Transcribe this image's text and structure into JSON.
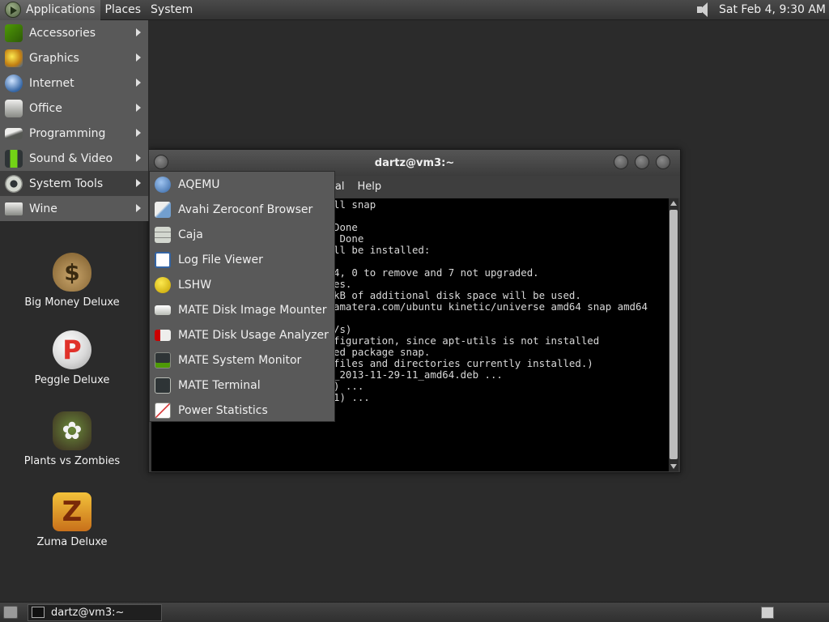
{
  "top_panel": {
    "menus": [
      {
        "label": "Applications"
      },
      {
        "label": "Places"
      },
      {
        "label": "System"
      }
    ],
    "clock": "Sat Feb  4,  9:30 AM"
  },
  "apps_menu": {
    "items": [
      {
        "label": "Accessories",
        "icon": "accessories-icon",
        "color": "#4e9a06"
      },
      {
        "label": "Graphics",
        "icon": "graphics-icon",
        "color": "#c17d11"
      },
      {
        "label": "Internet",
        "icon": "internet-icon",
        "color": "#3465a4"
      },
      {
        "label": "Office",
        "icon": "office-icon",
        "color": "#babdb6"
      },
      {
        "label": "Programming",
        "icon": "programming-icon",
        "color": "#888a85"
      },
      {
        "label": "Sound & Video",
        "icon": "sound-video-icon",
        "color": "#73d216"
      },
      {
        "label": "System Tools",
        "icon": "gear-icon",
        "color": "#d3d7cf"
      },
      {
        "label": "Wine",
        "icon": "wine-icon",
        "color": "#babdb6"
      }
    ]
  },
  "system_tools_menu": {
    "items": [
      {
        "label": "AQEMU",
        "icon": "aqemu-icon",
        "color": "#3465a4"
      },
      {
        "label": "Avahi Zeroconf Browser",
        "icon": "avahi-icon",
        "color": "#729fcf"
      },
      {
        "label": "Caja",
        "icon": "file-cabinet-icon",
        "color": "#d3d7cf"
      },
      {
        "label": "Log File Viewer",
        "icon": "magnifier-icon",
        "color": "#ffffff"
      },
      {
        "label": "LSHW",
        "icon": "lshw-icon",
        "color": "#edd400"
      },
      {
        "label": "MATE Disk Image Mounter",
        "icon": "disk-icon",
        "color": "#eeeeec"
      },
      {
        "label": "MATE Disk Usage Analyzer",
        "icon": "disk-usage-icon",
        "color": "#cc0000"
      },
      {
        "label": "MATE System Monitor",
        "icon": "system-monitor-icon",
        "color": "#4e9a06"
      },
      {
        "label": "MATE Terminal",
        "icon": "terminal-icon",
        "color": "#2e3436"
      },
      {
        "label": "Power Statistics",
        "icon": "power-statistics-icon",
        "color": "#ffffff"
      }
    ]
  },
  "terminal": {
    "title": "dartz@vm3:~",
    "menus": [
      "inal",
      "Help"
    ],
    "lines": [
      "ll snap",
      "",
      "Done",
      " Done",
      "ll be installed:",
      "",
      "4, 0 to remove and 7 not upgraded.",
      "es.",
      "kB of additional disk space will be used.",
      "amatera.com/ubuntu kinetic/universe amd64 snap amd64",
      "",
      "/s)",
      "figuration, since apt-utils is not installed",
      "ed package snap.",
      "files and directories currently installed.)",
      "_2013-11-29-11_amd64.deb ...",
      ") ...",
      "1) ..."
    ]
  },
  "desktop_icons": [
    {
      "label": "Big Money Deluxe",
      "icon": "money-bag-icon",
      "glyph": "$",
      "color": "#c8a46a"
    },
    {
      "label": "Peggle Deluxe",
      "icon": "peggle-icon",
      "glyph": "P",
      "color": "#e0322a"
    },
    {
      "label": "Plants vs Zombies",
      "icon": "flower-icon",
      "glyph": "✿",
      "color": "#f2f2f2"
    },
    {
      "label": "Zuma Deluxe",
      "icon": "zuma-icon",
      "glyph": "Z",
      "color": "#e8a020"
    }
  ],
  "bottom_panel": {
    "task_label": "dartz@vm3:~"
  }
}
